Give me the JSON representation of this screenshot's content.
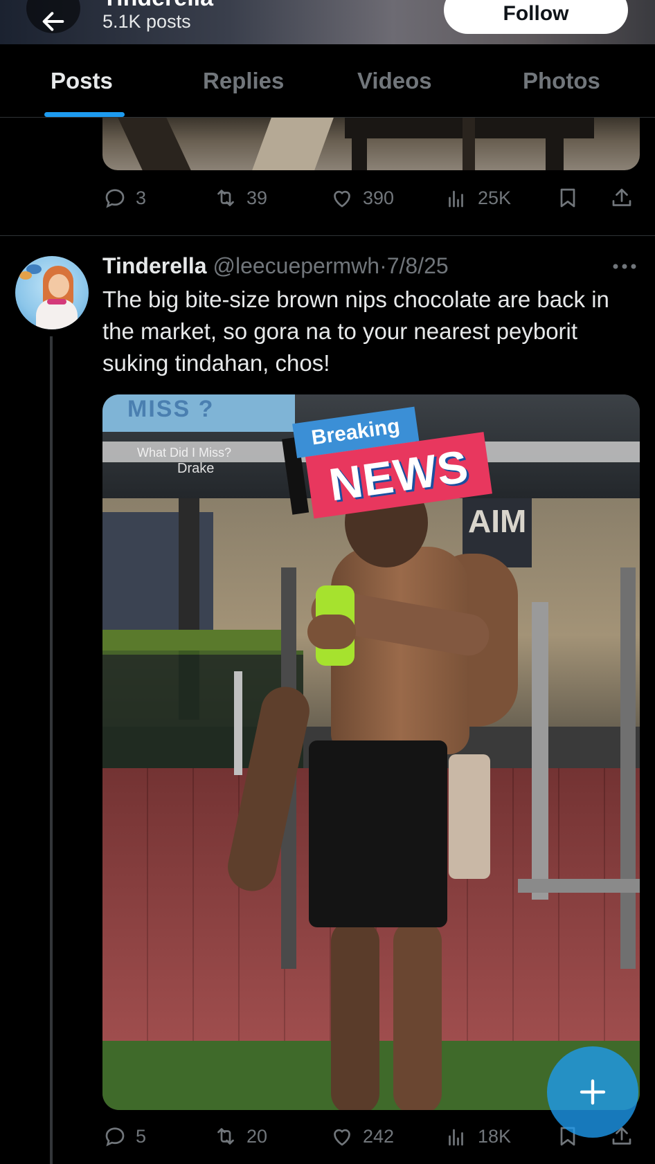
{
  "header": {
    "profile_name": "Tinderella",
    "post_count": "5.1K posts",
    "follow_label": "Follow"
  },
  "tabs": [
    {
      "label": "Posts",
      "active": true
    },
    {
      "label": "Replies",
      "active": false
    },
    {
      "label": "Videos",
      "active": false
    },
    {
      "label": "Photos",
      "active": false
    }
  ],
  "previous_post": {
    "replies": "3",
    "reposts": "39",
    "likes": "390",
    "views": "25K"
  },
  "post": {
    "display_name": "Tinderella",
    "handle": "@leecuepermwh",
    "separator": "·",
    "date": "7/8/25",
    "text": "The big bite-size brown nips chocolate are back in the market, so gora na to your nearest peyborit suking tindahan, chos!",
    "media": {
      "tv_text": "MISS ?",
      "caption_song": "What Did I Miss?",
      "caption_artist": "Drake",
      "sign_text": "AIM",
      "sticker_top": "Breaking",
      "sticker_main": "NEWS"
    },
    "replies": "5",
    "reposts": "20",
    "likes": "242",
    "views": "18K"
  },
  "colors": {
    "accent": "#1d9bf0",
    "text_primary": "#e7e9ea",
    "text_secondary": "#71767b",
    "background": "#000000"
  },
  "icons": [
    "back-arrow-icon",
    "reply-icon",
    "repost-icon",
    "like-icon",
    "views-icon",
    "bookmark-icon",
    "share-icon",
    "more-icon",
    "compose-plus-icon"
  ]
}
